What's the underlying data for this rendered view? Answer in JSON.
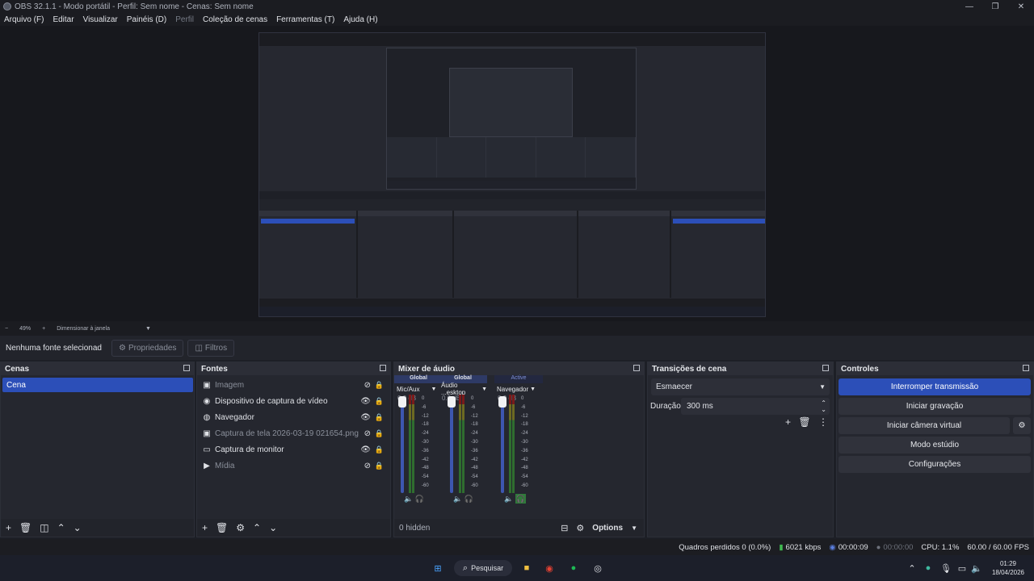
{
  "window": {
    "title": "OBS 32.1.1 - Modo portátil - Perfil: Sem nome - Cenas: Sem nome"
  },
  "menu": [
    "Arquivo (F)",
    "Editar",
    "Visualizar",
    "Painéis (D)",
    "Perfil",
    "Coleção de cenas",
    "Ferramentas (T)",
    "Ajuda (H)"
  ],
  "zoombar": {
    "minus": "−",
    "zoom": "49%",
    "plus": "+",
    "mode": "Dimensionar à janela"
  },
  "source_bar": {
    "label": "Nenhuma fonte selecionad",
    "properties": "Propriedades",
    "filters": "Filtros"
  },
  "scenes": {
    "title": "Cenas",
    "items": [
      "Cena"
    ]
  },
  "sources": {
    "title": "Fontes",
    "items": [
      {
        "name": "Imagem",
        "icon": "image-icon",
        "visible": false
      },
      {
        "name": "Dispositivo de captura de vídeo",
        "icon": "camera-icon",
        "visible": true
      },
      {
        "name": "Navegador",
        "icon": "globe-icon",
        "visible": true
      },
      {
        "name": "Captura de tela 2026-03-19 021654.png",
        "icon": "image-icon",
        "visible": false
      },
      {
        "name": "Captura de monitor",
        "icon": "monitor-icon",
        "visible": true
      },
      {
        "name": "Mídia",
        "icon": "play-icon",
        "visible": false
      }
    ]
  },
  "mixer": {
    "title": "Mixer de áudio",
    "channels": [
      {
        "tag": "Global",
        "name": "Mic/Aux",
        "db": "0.0 dB"
      },
      {
        "tag": "Global",
        "name": "Áudio ...esktop",
        "db": "0.0 dB"
      },
      {
        "tag": "Active",
        "name": "Navegador",
        "db": "0.0 dB"
      }
    ],
    "ticks": [
      "0",
      "-6",
      "-12",
      "-18",
      "-24",
      "-30",
      "-36",
      "-42",
      "-48",
      "-54",
      "-60"
    ],
    "hidden": "0 hidden",
    "options": "Options"
  },
  "transitions": {
    "title": "Transições de cena",
    "selected": "Esmaecer",
    "duration_label": "Duração",
    "duration": "300 ms"
  },
  "controls": {
    "title": "Controles",
    "buttons": [
      "Interromper transmissão",
      "Iniciar gravação",
      "Iniciar câmera virtual",
      "Modo estúdio",
      "Configurações"
    ]
  },
  "status": {
    "dropped": "Quadros perdidos 0 (0.0%)",
    "kbps": "6021 kbps",
    "stream_time": "00:00:09",
    "rec_time": "00:00:00",
    "cpu": "CPU: 1.1%",
    "fps": "60.00 / 60.00 FPS"
  },
  "taskbar": {
    "search": "Pesquisar",
    "time": "01:29",
    "date": "18/04/2026"
  },
  "colors": {
    "accent": "#2c4fb8",
    "bg": "#1d1f26",
    "dock": "#25272f"
  }
}
